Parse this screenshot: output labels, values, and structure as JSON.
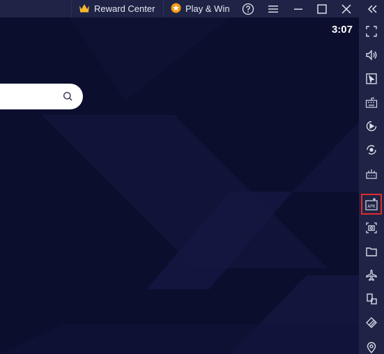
{
  "titlebar": {
    "reward_center_label": "Reward Center",
    "play_win_label": "Play & Win",
    "icons": [
      "crown-icon",
      "star-coin-icon",
      "help-icon",
      "menu-icon",
      "minimize-icon",
      "maximize-icon",
      "close-icon",
      "collapse-sidebar-icon"
    ]
  },
  "main": {
    "clock": "3:07"
  },
  "sidebar": {
    "items": [
      {
        "name": "fullscreen-icon"
      },
      {
        "name": "volume-icon"
      },
      {
        "name": "pointer-icon"
      },
      {
        "name": "keyboard-controls-icon"
      },
      {
        "name": "media-record-icon"
      },
      {
        "name": "rotate-icon"
      },
      {
        "name": "macro-icon"
      },
      {
        "name": "install-apk-icon",
        "label": "APK",
        "highlighted": true
      },
      {
        "name": "screenshot-icon"
      },
      {
        "name": "folder-icon"
      },
      {
        "name": "airplane-mode-icon"
      },
      {
        "name": "multi-instance-icon"
      },
      {
        "name": "eco-mode-icon"
      },
      {
        "name": "location-icon"
      }
    ]
  },
  "colors": {
    "titlebar_bg": "#1f2345",
    "main_bg": "#0b0e2d",
    "highlight": "#e32a2a",
    "accent_orange": "#f39c12",
    "crown_gold": "#f5b82e"
  }
}
